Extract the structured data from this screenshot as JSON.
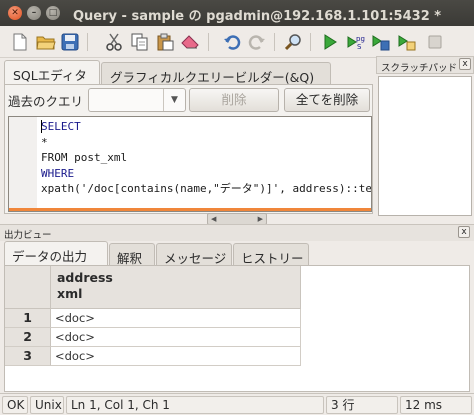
{
  "window": {
    "title": "Query - sample の pgadmin@192.168.1.101:5432 *"
  },
  "toolbar": {
    "icons": [
      "new-file-icon",
      "open-folder-icon",
      "save-icon",
      "cut-icon",
      "copy-icon",
      "paste-icon",
      "eraser-icon",
      "undo-icon",
      "redo-icon",
      "find-icon",
      "execute-icon",
      "execute-pgscript-icon",
      "execute-to-file-icon",
      "explain-icon",
      "stop-icon"
    ]
  },
  "query_tabs": [
    {
      "label": "SQLエディタ",
      "active": true
    },
    {
      "label": "グラフィカルクエリービルダー(&Q)",
      "active": false
    }
  ],
  "history": {
    "label": "過去のクエリ",
    "selected": "",
    "delete_label": "削除",
    "delete_all_label": "全てを削除"
  },
  "editor": {
    "lines": [
      "SELECT",
      "*",
      "FROM post_xml",
      "WHERE",
      "xpath('/doc[contains(name,\"データ\")]', address)::te"
    ]
  },
  "scratchpad": {
    "title": "スクラッチパッド",
    "close": "x"
  },
  "output": {
    "title": "出力ビュー",
    "close": "x",
    "tabs": [
      {
        "label": "データの出力",
        "active": true
      },
      {
        "label": "解釈",
        "active": false
      },
      {
        "label": "メッセージ",
        "active": false
      },
      {
        "label": "ヒストリー",
        "active": false
      }
    ],
    "columns": [
      {
        "name": "address",
        "type": "xml"
      }
    ],
    "rows": [
      {
        "num": "1",
        "value": "<doc>"
      },
      {
        "num": "2",
        "value": "<doc>"
      },
      {
        "num": "3",
        "value": "<doc>"
      }
    ]
  },
  "status": {
    "state": "OK",
    "line_ending": "Unix",
    "position": "Ln 1, Col 1, Ch 1",
    "rows": "3 行",
    "time": "12 ms"
  },
  "colors": {
    "accent_orange": "#f0863a",
    "keyword_blue": "#1a1a8c",
    "titlebar": "#3b3a36"
  }
}
